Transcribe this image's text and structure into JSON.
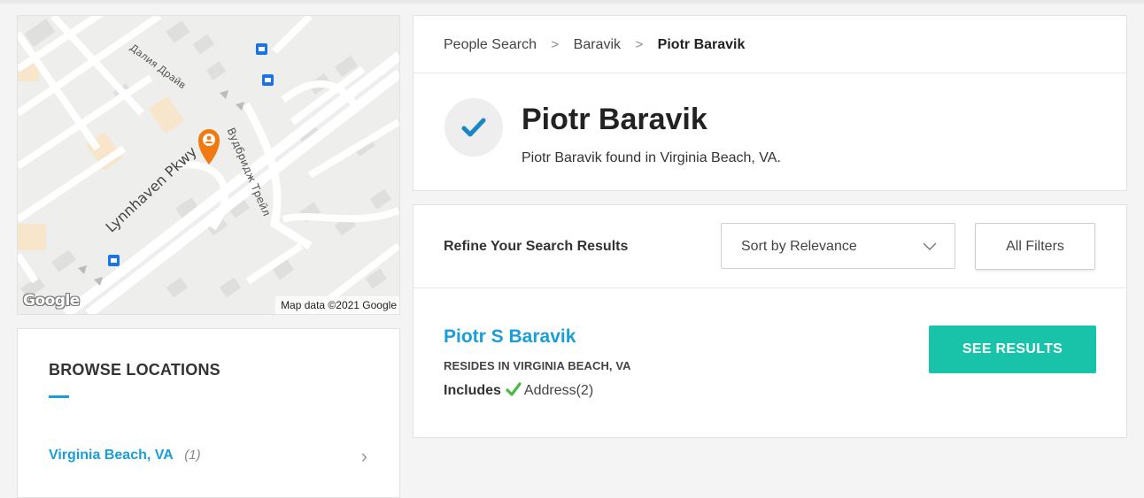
{
  "map": {
    "street_labels": [
      "Далия Драйв",
      "Lynnhaven Pkwy",
      "Вудбридж Трейл"
    ],
    "logo_text": "Google",
    "credit": "Map data ©2021 Google",
    "pin_color": "#f07a12"
  },
  "browse": {
    "title": "BROWSE LOCATIONS",
    "items": [
      {
        "name": "Virginia Beach, VA",
        "count": "(1)"
      }
    ]
  },
  "breadcrumb": {
    "items": [
      "People Search",
      "Baravik"
    ],
    "current": "Piotr Baravik"
  },
  "profile": {
    "name": "Piotr Baravik",
    "subtitle": "Piotr Baravik found in Virginia Beach, VA."
  },
  "refine": {
    "label": "Refine Your Search Results",
    "sort_value": "Sort by Relevance",
    "filters_label": "All Filters"
  },
  "result": {
    "name": "Piotr S Baravik",
    "resides": "RESIDES IN VIRGINIA BEACH, VA",
    "includes_label": "Includes",
    "includes_item": "Address(2)",
    "button_label": "SEE RESULTS"
  },
  "colors": {
    "link_blue": "#1a9ed9",
    "button_teal": "#19c3a9",
    "check_green": "#4cb944"
  }
}
